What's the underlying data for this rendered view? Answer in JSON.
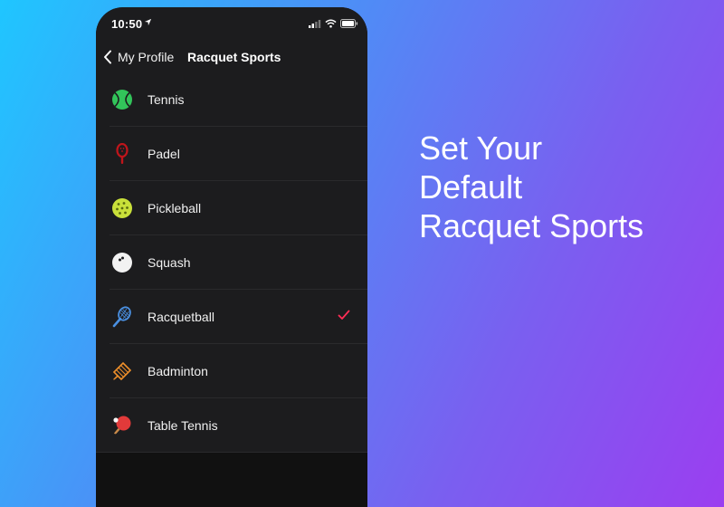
{
  "status_bar": {
    "time": "10:50",
    "icons": [
      "location-arrow-icon",
      "signal-icon",
      "wifi-icon",
      "battery-icon"
    ]
  },
  "nav": {
    "back_label": "My Profile",
    "title": "Racquet Sports"
  },
  "sports": [
    {
      "label": "Tennis",
      "icon": "tennis-ball-icon",
      "selected": false
    },
    {
      "label": "Padel",
      "icon": "padel-racket-icon",
      "selected": false
    },
    {
      "label": "Pickleball",
      "icon": "pickleball-icon",
      "selected": false
    },
    {
      "label": "Squash",
      "icon": "squash-ball-icon",
      "selected": false
    },
    {
      "label": "Racquetball",
      "icon": "racquetball-racket-icon",
      "selected": true
    },
    {
      "label": "Badminton",
      "icon": "shuttlecock-icon",
      "selected": false
    },
    {
      "label": "Table Tennis",
      "icon": "table-tennis-paddle-icon",
      "selected": false
    }
  ],
  "headline": {
    "line1": "Set Your",
    "line2": "Default",
    "line3": "Racquet Sports"
  },
  "colors": {
    "check": "#ff2d55",
    "list_bg": "#1c1c1e",
    "background_start": "#1fc6ff",
    "background_end": "#9b3ef0"
  }
}
